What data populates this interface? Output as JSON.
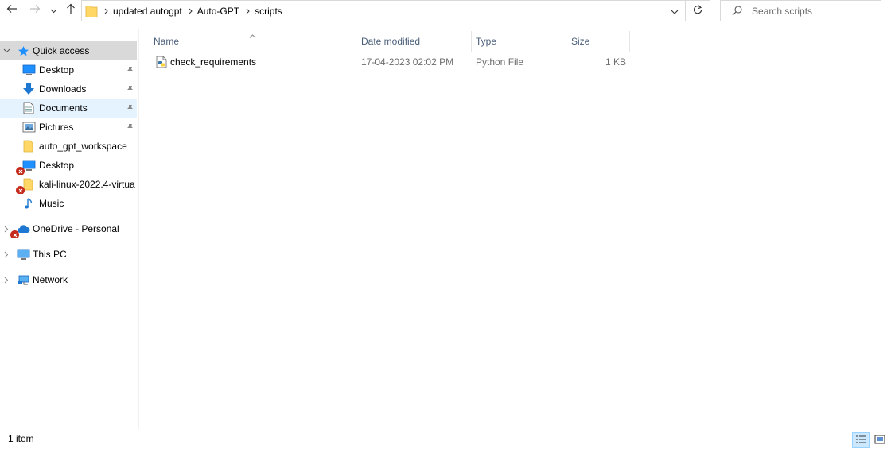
{
  "toolbar": {
    "back_icon": "arrow-left-icon",
    "forward_icon": "arrow-right-icon",
    "recent_icon": "chevron-down-icon",
    "up_icon": "arrow-up-icon"
  },
  "address": {
    "breadcrumbs": [
      "updated autogpt",
      "Auto-GPT",
      "scripts"
    ]
  },
  "search": {
    "placeholder": "Search scripts"
  },
  "navigation": {
    "items": [
      {
        "label": "Quick access",
        "icon": "star-icon"
      },
      {
        "label": "Desktop",
        "icon": "desktop-icon",
        "pinned": true
      },
      {
        "label": "Downloads",
        "icon": "download-arrow-icon",
        "pinned": true
      },
      {
        "label": "Documents",
        "icon": "documents-icon",
        "pinned": true
      },
      {
        "label": "Pictures",
        "icon": "pictures-icon",
        "pinned": true
      },
      {
        "label": "auto_gpt_workspace",
        "icon": "folder-icon"
      },
      {
        "label": "Desktop",
        "icon": "desktop-icon",
        "error": true
      },
      {
        "label": "kali-linux-2022.4-virtua",
        "icon": "folder-icon",
        "error": true
      },
      {
        "label": "Music",
        "icon": "music-note-icon"
      },
      {
        "label": "OneDrive - Personal",
        "icon": "cloud-icon",
        "error": true
      },
      {
        "label": "This PC",
        "icon": "computer-icon"
      },
      {
        "label": "Network",
        "icon": "network-icon"
      }
    ]
  },
  "columns": {
    "name": "Name",
    "date_modified": "Date modified",
    "type": "Type",
    "size": "Size"
  },
  "files": [
    {
      "name": "check_requirements",
      "date_modified": "17-04-2023 02:02 PM",
      "type": "Python File",
      "size": "1 KB",
      "icon": "python-file-icon"
    }
  ],
  "status": {
    "item_count": "1 item"
  },
  "colors": {
    "selection": "#cce8ff",
    "quick_access_bg": "#d9d9d9",
    "folder": "#ffd767",
    "accent": "#0078d7",
    "error": "#c42b1c"
  }
}
